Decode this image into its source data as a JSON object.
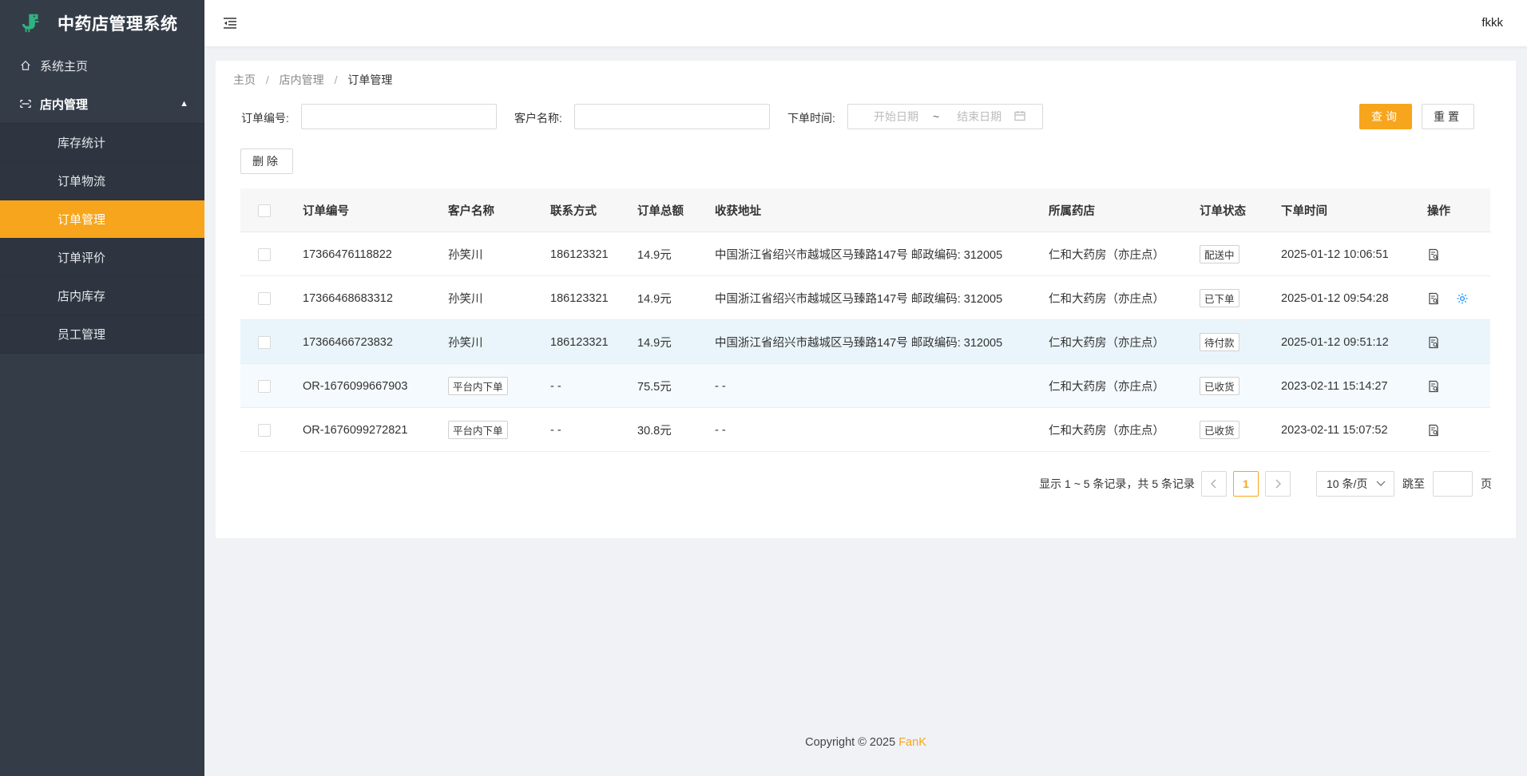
{
  "app": {
    "title": "中药店管理系统",
    "username": "fkkk",
    "accent_color": "#f7a51c"
  },
  "sidebar": {
    "home_label": "系统主页",
    "group_label": "店内管理",
    "items": [
      {
        "label": "库存统计"
      },
      {
        "label": "订单物流"
      },
      {
        "label": "订单管理"
      },
      {
        "label": "订单评价"
      },
      {
        "label": "店内库存"
      },
      {
        "label": "员工管理"
      }
    ]
  },
  "breadcrumb": {
    "home": "主页",
    "parent": "店内管理",
    "current": "订单管理",
    "separator": "/"
  },
  "filters": {
    "order_no_label": "订单编号:",
    "order_no_value": "",
    "customer_label": "客户名称:",
    "customer_value": "",
    "date_label": "下单时间:",
    "start_placeholder": "开始日期",
    "range_sep": "~",
    "end_placeholder": "结束日期",
    "query_label": "查询",
    "reset_label": "重置"
  },
  "toolbar": {
    "delete_label": "删除"
  },
  "table": {
    "columns": [
      "订单编号",
      "客户名称",
      "联系方式",
      "订单总额",
      "收获地址",
      "所属药店",
      "订单状态",
      "下单时间",
      "操作"
    ],
    "rows": [
      {
        "order_no": "17366476118822",
        "customer": "孙笑川",
        "customer_is_tag": false,
        "phone": "186123321",
        "amount": "14.9元",
        "address": "中国浙江省绍兴市越城区马臻路147号 邮政编码: 312005",
        "store": "仁和大药房（亦庄点）",
        "status": "配送中",
        "time": "2025-01-12 10:06:51",
        "has_settings": false
      },
      {
        "order_no": "17366468683312",
        "customer": "孙笑川",
        "customer_is_tag": false,
        "phone": "186123321",
        "amount": "14.9元",
        "address": "中国浙江省绍兴市越城区马臻路147号 邮政编码: 312005",
        "store": "仁和大药房（亦庄点）",
        "status": "已下单",
        "time": "2025-01-12 09:54:28",
        "has_settings": true
      },
      {
        "order_no": "17366466723832",
        "customer": "孙笑川",
        "customer_is_tag": false,
        "phone": "186123321",
        "amount": "14.9元",
        "address": "中国浙江省绍兴市越城区马臻路147号 邮政编码: 312005",
        "store": "仁和大药房（亦庄点）",
        "status": "待付款",
        "time": "2025-01-12 09:51:12",
        "has_settings": false
      },
      {
        "order_no": "OR-1676099667903",
        "customer": "平台内下单",
        "customer_is_tag": true,
        "phone": "- -",
        "amount": "75.5元",
        "address": "- -",
        "store": "仁和大药房（亦庄点）",
        "status": "已收货",
        "time": "2023-02-11 15:14:27",
        "has_settings": false
      },
      {
        "order_no": "OR-1676099272821",
        "customer": "平台内下单",
        "customer_is_tag": true,
        "phone": "- -",
        "amount": "30.8元",
        "address": "- -",
        "store": "仁和大药房（亦庄点）",
        "status": "已收货",
        "time": "2023-02-11 15:07:52",
        "has_settings": false
      }
    ]
  },
  "pagination": {
    "summary": "显示 1 ~ 5 条记录，共 5 条记录",
    "current_page": "1",
    "page_size": "10 条/页",
    "jump_label": "跳至",
    "page_suffix": "页"
  },
  "footer": {
    "copyright": "Copyright © 2025",
    "brand": "FanK"
  }
}
